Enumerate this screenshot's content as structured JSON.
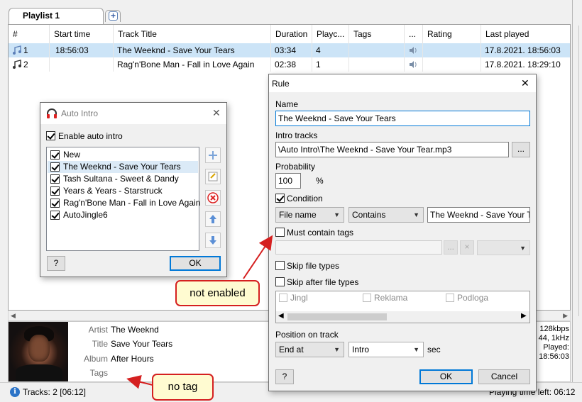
{
  "tabs": {
    "active_label": "Playlist 1",
    "add_label": "+"
  },
  "playlist": {
    "columns": [
      "#",
      "Start time",
      "Track Title",
      "Duration",
      "Playc...",
      "Tags",
      "...",
      "Rating",
      "Last played"
    ],
    "rows": [
      {
        "num": "1",
        "start": "18:56:03",
        "title": "The Weeknd - Save Your Tears",
        "duration": "03:34",
        "plays": "4",
        "last": "17.8.2021. 18:56:03"
      },
      {
        "num": "2",
        "start": "",
        "title": "Rag'n'Bone Man - Fall in Love Again",
        "duration": "02:38",
        "plays": "1",
        "last": "17.8.2021. 18:29:10"
      }
    ],
    "scroll_left": "◀",
    "scroll_right": "▶"
  },
  "info": {
    "labels": {
      "artist": "Artist",
      "title": "Title",
      "album": "Album",
      "tags": "Tags"
    },
    "values": {
      "artist": "The Weeknd",
      "title": "Save Your Tears",
      "album": "After Hours",
      "tags": ""
    },
    "right": [
      "128kbps",
      "44, 1kHz",
      "Played:",
      "18:56:03"
    ]
  },
  "status": {
    "icon": "i",
    "tracks": "Tracks: 2 [06:12]",
    "playtime": "Playing time left: 06:12"
  },
  "auto_intro": {
    "title": "Auto Intro",
    "close": "✕",
    "enable_label": "Enable auto intro",
    "items": [
      "New",
      "The Weeknd - Save Your Tears",
      "Tash Sultana - Sweet & Dandy",
      "Years & Years - Starstruck",
      "Rag'n'Bone Man - Fall in Love Again",
      "AutoJingle6"
    ],
    "help": "?",
    "ok": "OK"
  },
  "rule": {
    "title": "Rule",
    "close": "✕",
    "name_label": "Name",
    "name_value": "The Weeknd - Save Your Tears",
    "intro_label": "Intro tracks",
    "intro_value": "\\Auto Intro\\The Weeknd - Save Your Tear.mp3",
    "browse": "...",
    "probability_label": "Probability",
    "probability_value": "100",
    "percent": "%",
    "condition_label": "Condition",
    "cond_field": "File name",
    "cond_op": "Contains",
    "cond_value": "The Weeknd - Save Your Tears",
    "must_tags_label": "Must contain tags",
    "tags_btn1": "...",
    "tags_btn2": "×",
    "skip_types_label": "Skip file types",
    "skip_after_label": "Skip after file types",
    "file_types": [
      "Jingl",
      "Reklama",
      "Podloga"
    ],
    "position_label": "Position on track",
    "pos_mode": "End at",
    "pos_point": "Intro",
    "sec": "sec",
    "help": "?",
    "ok": "OK",
    "cancel": "Cancel"
  },
  "callouts": {
    "not_enabled": "not enabled",
    "no_tag": "no tag"
  },
  "colors": {
    "selection": "#cce4f7",
    "accent": "#0078d7",
    "callout_border": "#d52020",
    "callout_fill": "#fffbd1"
  }
}
